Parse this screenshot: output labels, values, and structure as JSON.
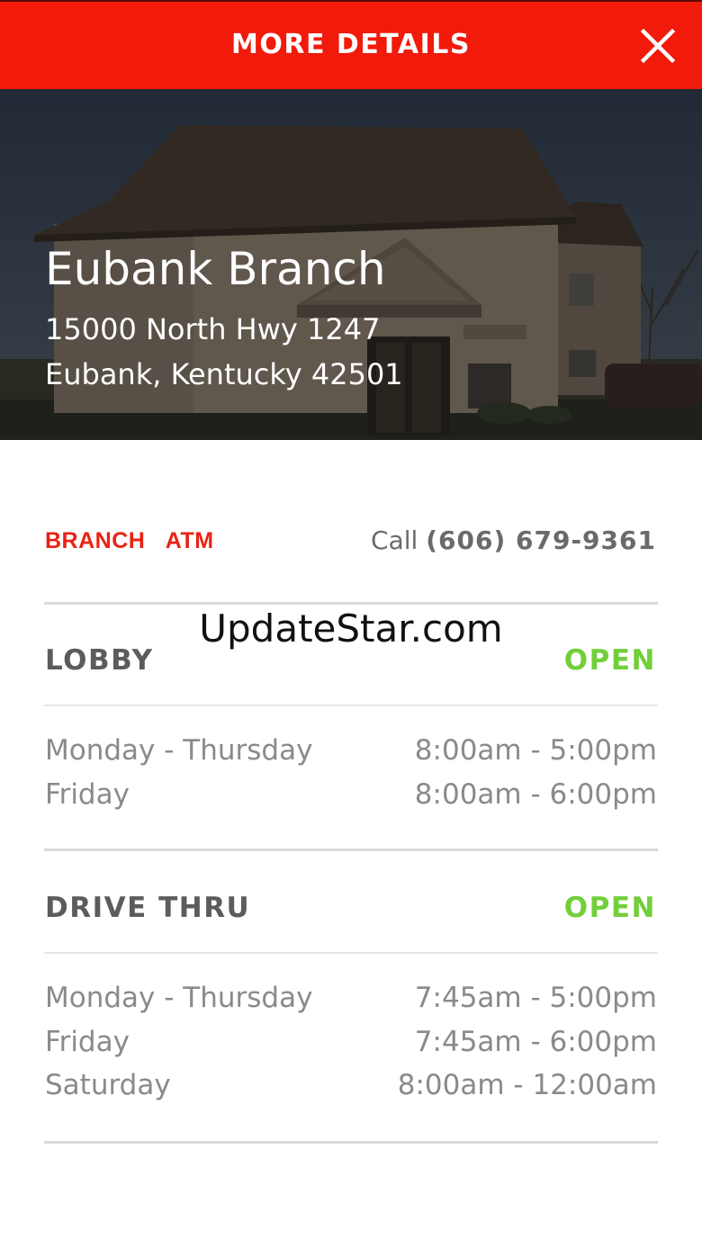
{
  "header": {
    "title": "MORE DETAILS"
  },
  "branch": {
    "name": "Eubank Branch",
    "address_line1": "15000 North Hwy 1247",
    "address_line2": "Eubank, Kentucky 42501"
  },
  "tabs": [
    {
      "label": "BRANCH"
    },
    {
      "label": "ATM"
    }
  ],
  "call": {
    "label": "Call",
    "number": "(606) 679-9361"
  },
  "watermark": "UpdateStar.com",
  "sections": [
    {
      "title": "LOBBY",
      "status": "OPEN",
      "hours": [
        {
          "day": "Monday - Thursday",
          "time": "8:00am - 5:00pm"
        },
        {
          "day": "Friday",
          "time": "8:00am - 6:00pm"
        }
      ]
    },
    {
      "title": "DRIVE THRU",
      "status": "OPEN",
      "hours": [
        {
          "day": "Monday - Thursday",
          "time": "7:45am - 5:00pm"
        },
        {
          "day": "Friday",
          "time": "7:45am - 6:00pm"
        },
        {
          "day": "Saturday",
          "time": "8:00am - 12:00am"
        }
      ]
    }
  ],
  "colors": {
    "accent": "#f11a0b",
    "open": "#72cf3a",
    "tab": "#ea2214"
  },
  "icons": {
    "close": "close-icon"
  }
}
